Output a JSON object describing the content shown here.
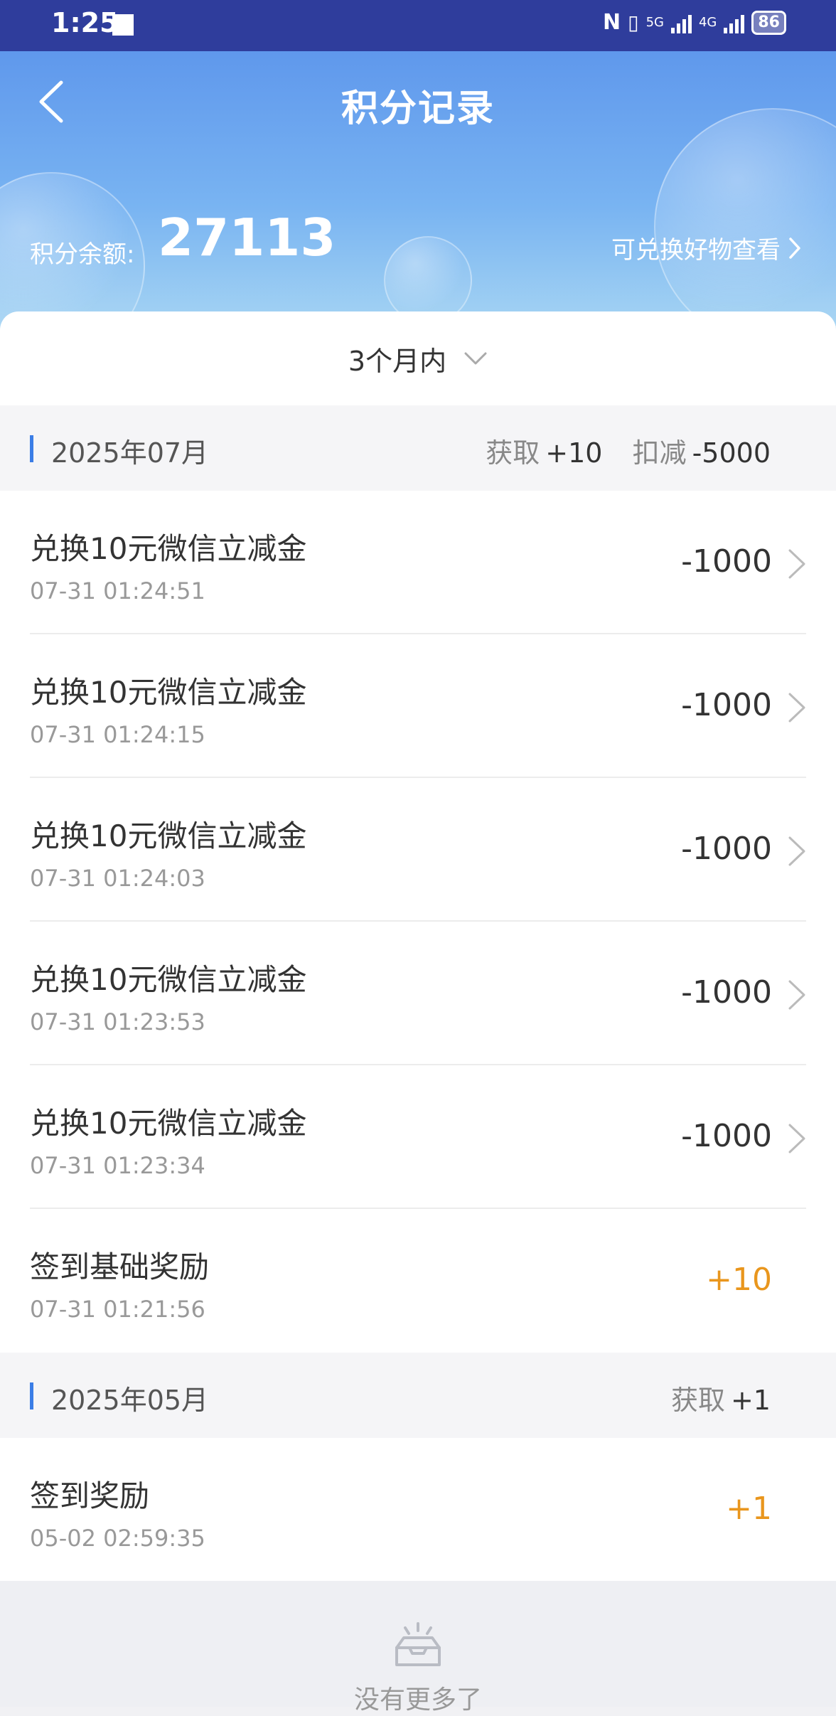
{
  "status": {
    "time": "1:25",
    "net1": "5G",
    "net2": "4G",
    "battery": "86"
  },
  "header": {
    "title": "积分记录",
    "balance_label": "积分余额:",
    "balance_value": "27113",
    "redeem_link": "可兑换好物查看"
  },
  "filter": {
    "label": "3个月内"
  },
  "months": [
    {
      "label": "2025年07月",
      "gain_label": "获取",
      "gain_value": "+10",
      "deduct_label": "扣减",
      "deduct_value": "-5000",
      "records": [
        {
          "title": "兑换10元微信立减金",
          "time": "07-31 01:24:51",
          "amount": "-1000"
        },
        {
          "title": "兑换10元微信立减金",
          "time": "07-31 01:24:15",
          "amount": "-1000"
        },
        {
          "title": "兑换10元微信立减金",
          "time": "07-31 01:24:03",
          "amount": "-1000"
        },
        {
          "title": "兑换10元微信立减金",
          "time": "07-31 01:23:53",
          "amount": "-1000"
        },
        {
          "title": "兑换10元微信立减金",
          "time": "07-31 01:23:34",
          "amount": "-1000"
        },
        {
          "title": "签到基础奖励",
          "time": "07-31 01:21:56",
          "amount": "+10"
        }
      ]
    },
    {
      "label": "2025年05月",
      "gain_label": "获取",
      "gain_value": "+1",
      "records": [
        {
          "title": "签到奖励",
          "time": "05-02 02:59:35",
          "amount": "+1"
        }
      ]
    }
  ],
  "footer": {
    "no_more": "没有更多了"
  },
  "colors": {
    "accent": "#3b7de6",
    "positive": "#e9961d",
    "header_top": "#5f98ec",
    "statusbar": "#2f3d9c"
  }
}
